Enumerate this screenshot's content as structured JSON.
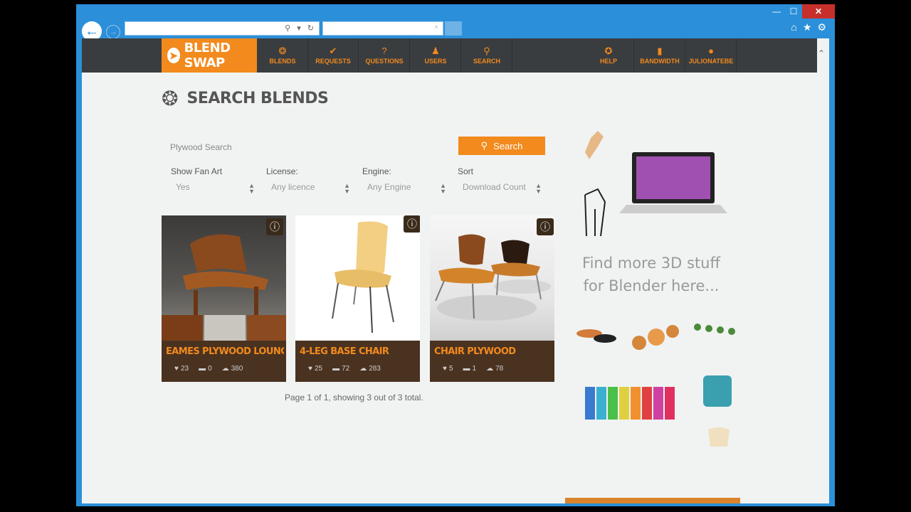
{
  "browser": {
    "window_controls": {
      "minimize": "—",
      "maximize": "☐",
      "close": "✕"
    },
    "address_value": "",
    "tab_title": "",
    "tab_close": "×",
    "address_icons": "⚲ ▾ ↻"
  },
  "nav": {
    "logo": "BLEND SWAP",
    "items": [
      {
        "label": "BLENDS",
        "icon": "blends-icon"
      },
      {
        "label": "REQUESTS",
        "icon": "check-icon"
      },
      {
        "label": "QUESTIONS",
        "icon": "question-icon"
      },
      {
        "label": "USERS",
        "icon": "users-icon"
      },
      {
        "label": "SEARCH",
        "icon": "search-icon"
      },
      {
        "label": "HELP",
        "icon": "help-icon"
      },
      {
        "label": "BANDWIDTH",
        "icon": "bandwidth-icon"
      },
      {
        "label": "JULIONATEBE",
        "icon": "user-icon"
      }
    ]
  },
  "page": {
    "title": "SEARCH BLENDS",
    "search": {
      "value": "Plywood Search",
      "button": "Search"
    },
    "filters": [
      {
        "label": "Show Fan Art",
        "value": "Yes"
      },
      {
        "label": "License:",
        "value": "Any licence"
      },
      {
        "label": "Engine:",
        "value": "Any Engine"
      },
      {
        "label": "Sort",
        "value": "Download Count"
      }
    ],
    "results": [
      {
        "title": "EAMES PLYWOOD LOUNGE ...",
        "likes": "23",
        "comments": "0",
        "downloads": "380"
      },
      {
        "title": "4-LEG BASE CHAIR",
        "likes": "25",
        "comments": "72",
        "downloads": "283"
      },
      {
        "title": "CHAIR PLYWOOD",
        "likes": "5",
        "comments": "1",
        "downloads": "78"
      }
    ],
    "pagination": "Page 1 of 1, showing 3 out of 3 total."
  },
  "sidebar": {
    "promo_line1": "Find more 3D stuff",
    "promo_line2": "for Blender here..."
  },
  "colors": {
    "accent": "#f28a1d",
    "nav_bg": "#3a3d40",
    "card_bar": "#4a3220",
    "browser_chrome": "#2b8fd9"
  }
}
